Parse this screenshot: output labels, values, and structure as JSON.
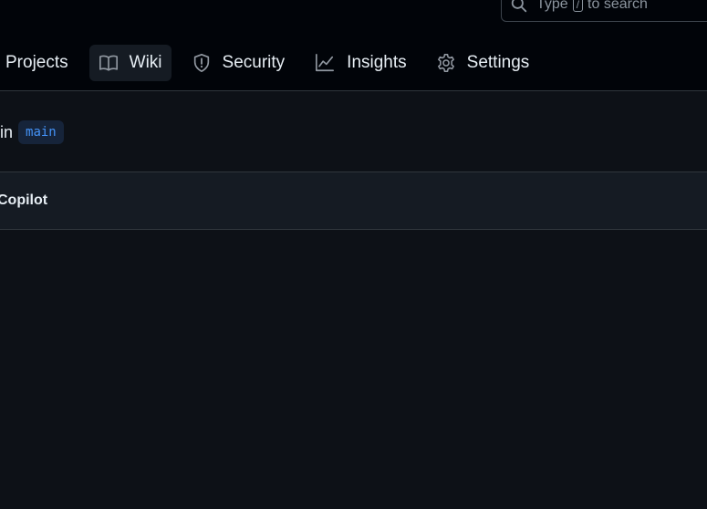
{
  "search": {
    "prefix": "Type",
    "key": "/",
    "suffix": "to search"
  },
  "tabs": [
    {
      "label": "Projects",
      "icon": "projects-icon"
    },
    {
      "label": "Wiki",
      "icon": "book-icon"
    },
    {
      "label": "Security",
      "icon": "shield-icon"
    },
    {
      "label": "Insights",
      "icon": "graph-icon"
    },
    {
      "label": "Settings",
      "icon": "gear-icon"
    }
  ],
  "branch": {
    "prefix": "in",
    "name": "main"
  },
  "copilot": {
    "label": "Copilot"
  },
  "colors": {
    "header_bg": "#010409",
    "page_bg": "#0d1117",
    "accent_blue": "#4493f8",
    "border": "#30363d"
  }
}
